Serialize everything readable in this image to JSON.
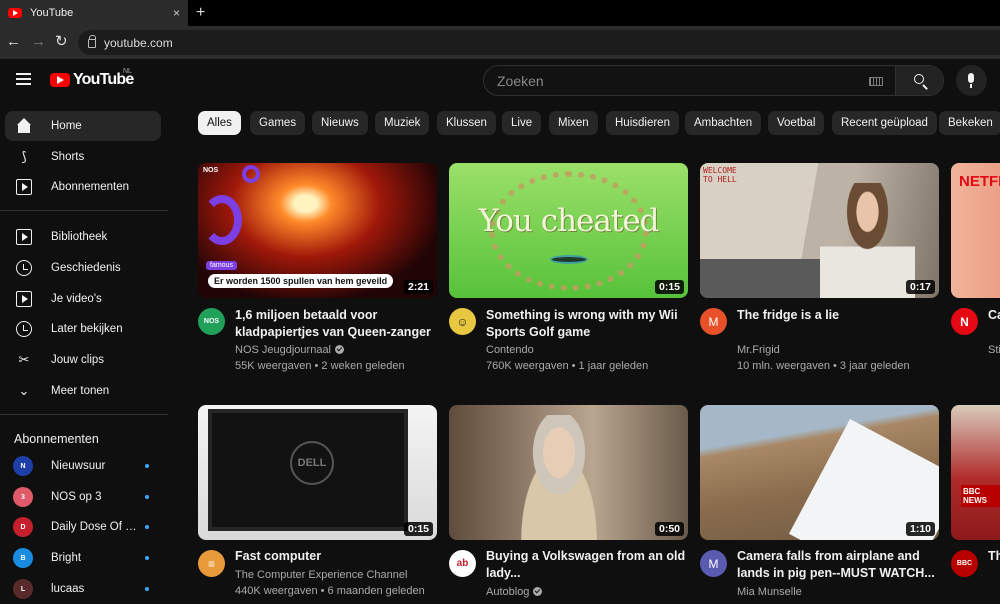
{
  "browser": {
    "tab_title": "YouTube",
    "url": "youtube.com",
    "new_tab_label": "+",
    "close_label": "×",
    "back_label": "←",
    "forward_label": "→",
    "reload_label": "↻"
  },
  "header": {
    "logo_text": "YouTube",
    "region": "NL",
    "search_placeholder": "Zoeken"
  },
  "sidebar": {
    "main": [
      {
        "label": "Home",
        "icon": "home-icon",
        "active": true
      },
      {
        "label": "Shorts",
        "icon": "shorts-icon"
      },
      {
        "label": "Abonnementen",
        "icon": "subscriptions-icon"
      }
    ],
    "library": [
      {
        "label": "Bibliotheek",
        "icon": "library-icon"
      },
      {
        "label": "Geschiedenis",
        "icon": "history-icon"
      },
      {
        "label": "Je video's",
        "icon": "your-videos-icon"
      },
      {
        "label": "Later bekijken",
        "icon": "watch-later-icon"
      },
      {
        "label": "Jouw clips",
        "icon": "scissors-icon"
      },
      {
        "label": "Meer tonen",
        "icon": "chevron-down-icon"
      }
    ],
    "subscriptions_heading": "Abonnementen",
    "subscriptions": [
      {
        "name": "Nieuwsuur",
        "color": "#1f3fa8",
        "abbr": "N"
      },
      {
        "name": "NOS op 3",
        "color": "#e05a6a",
        "abbr": "3"
      },
      {
        "name": "Daily Dose Of Int...",
        "color": "#c41f2c",
        "abbr": "D"
      },
      {
        "name": "Bright",
        "color": "#1a8ce0",
        "abbr": "B"
      },
      {
        "name": "lucaas",
        "color": "#5a2a2a",
        "abbr": "L"
      }
    ]
  },
  "chips": [
    "Alles",
    "Games",
    "Nieuws",
    "Muziek",
    "Klussen",
    "Live",
    "Mixen",
    "Huisdieren",
    "Ambachten",
    "Voetbal",
    "Recent geüpload",
    "Bekeken"
  ],
  "videos": [
    {
      "title": "1,6 miljoen betaald voor kladpapiertjes van Queen-zanger",
      "channel": "NOS Jeugdjournaal",
      "verified": true,
      "meta": "55K weergaven • 2 weken geleden",
      "duration": "2:21",
      "avatar_color": "#21a05a",
      "avatar_text": "NOS",
      "banner": "Er worden 1500 spullen van hem geveild",
      "badge": "famous",
      "logo": "NOS"
    },
    {
      "title": "Something is wrong with my Wii Sports Golf game",
      "channel": "Contendo",
      "verified": false,
      "meta": "760K weergaven • 1 jaar geleden",
      "duration": "0:15",
      "avatar_color": "#e8c840",
      "avatar_text": "☺",
      "overlay_text": "You cheated"
    },
    {
      "title": "The fridge is a lie",
      "channel": "Mr.Frigid",
      "verified": false,
      "meta": "10 mln. weergaven • 3 jaar geleden",
      "duration": "0:17",
      "avatar_color": "#e8502a",
      "avatar_text": "M",
      "overlay_text": "WELCOME TO HELL"
    },
    {
      "title": "Ca Sp",
      "channel": "Sti",
      "verified": false,
      "meta": "",
      "duration": "",
      "avatar_color": "#e50914",
      "avatar_text": "N",
      "overlay_text": "NETFLIX"
    },
    {
      "title": "Fast computer",
      "channel": "The Computer Experience Channel",
      "verified": false,
      "meta": "440K weergaven • 6 maanden geleden",
      "duration": "0:15",
      "avatar_color": "#e89a3a",
      "avatar_text": "≡",
      "overlay_text": "DELL"
    },
    {
      "title": "Buying a Volkswagen from an old lady...",
      "channel": "Autoblog",
      "verified": true,
      "meta": "",
      "duration": "0:50",
      "avatar_color": "#ffffff",
      "avatar_text": "ab"
    },
    {
      "title": "Camera falls from airplane and lands in pig pen--MUST WATCH...",
      "channel": "Mia Munselle",
      "verified": false,
      "meta": "",
      "duration": "1:10",
      "avatar_color": "#5a5ab0",
      "avatar_text": "M"
    },
    {
      "title": "Th Bo",
      "channel": "",
      "verified": false,
      "meta": "",
      "duration": "",
      "avatar_color": "#b80000",
      "avatar_text": "BBC",
      "overlay_text": "BBC NEWS"
    }
  ]
}
